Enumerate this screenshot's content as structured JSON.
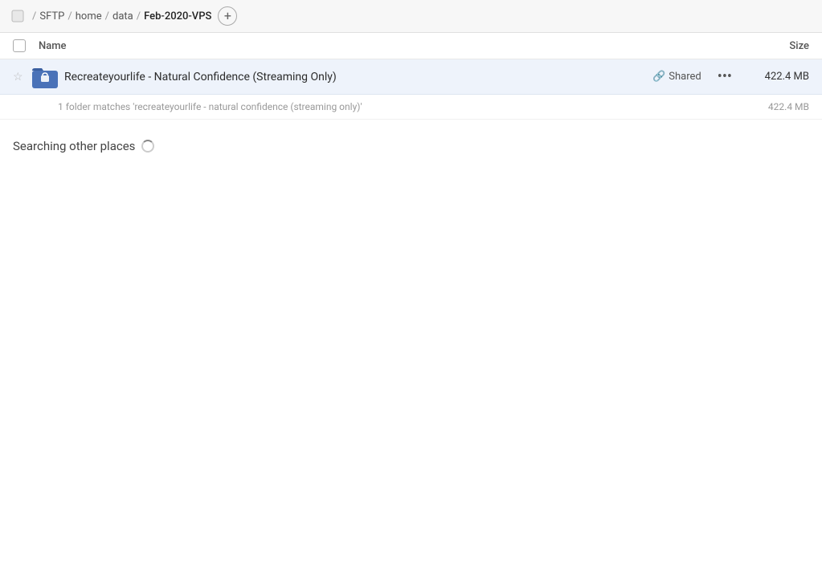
{
  "breadcrumb": {
    "home_icon": "🏠",
    "items": [
      {
        "label": "SFTP",
        "active": false
      },
      {
        "label": "home",
        "active": false
      },
      {
        "label": "data",
        "active": false
      },
      {
        "label": "Feb-2020-VPS",
        "active": true
      }
    ],
    "add_tab_label": "+"
  },
  "columns": {
    "name_label": "Name",
    "size_label": "Size"
  },
  "file_row": {
    "name": "Recreateyourlife - Natural Confidence (Streaming Only)",
    "shared_label": "Shared",
    "size": "422.4 MB",
    "more_icon": "···"
  },
  "match_info": {
    "text": "1 folder matches 'recreateyourlife - natural confidence (streaming only)'",
    "size": "422.4 MB"
  },
  "searching": {
    "label": "Searching other places"
  },
  "icons": {
    "star_empty": "☆",
    "link": "🔗",
    "ellipsis": "•••"
  }
}
